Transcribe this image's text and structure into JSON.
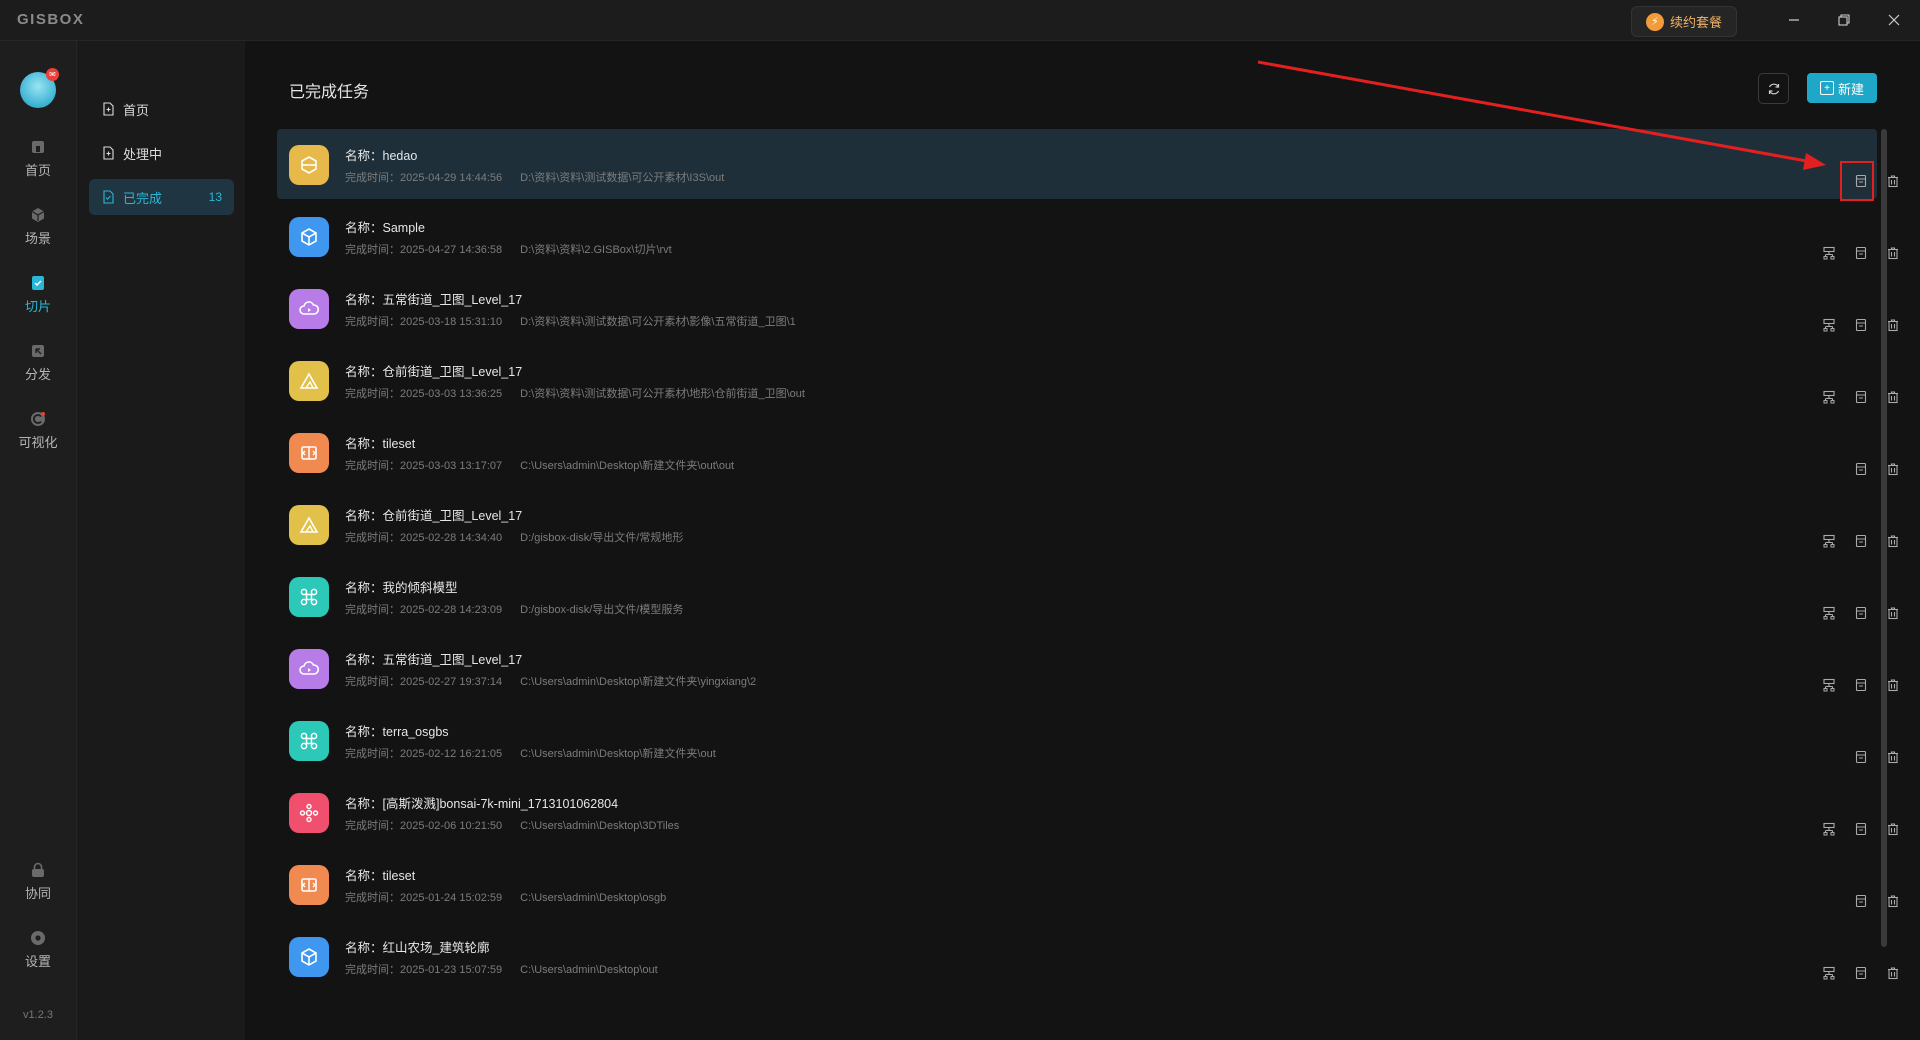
{
  "app": {
    "logo": "GISBOX",
    "renew_label": "续约套餐",
    "version": "v1.2.3"
  },
  "nav": {
    "items": [
      {
        "label": "首页",
        "icon": "home-icon"
      },
      {
        "label": "场景",
        "icon": "scene-icon"
      },
      {
        "label": "切片",
        "icon": "slice-icon",
        "active": true
      },
      {
        "label": "分发",
        "icon": "distribute-icon"
      },
      {
        "label": "可视化",
        "icon": "visualize-icon"
      }
    ],
    "bottom_items": [
      {
        "label": "协同",
        "icon": "collab-icon"
      },
      {
        "label": "设置",
        "icon": "settings-icon"
      }
    ]
  },
  "subnav": {
    "items": [
      {
        "label": "首页",
        "icon": "doc-icon"
      },
      {
        "label": "处理中",
        "icon": "doc-icon"
      },
      {
        "label": "已完成",
        "icon": "doc-check-icon",
        "count": "13",
        "active": true
      }
    ]
  },
  "main": {
    "title": "已完成任务",
    "new_label": "新建",
    "name_prefix": "名称：",
    "time_prefix": "完成时间：",
    "tasks": [
      {
        "name": "hedao",
        "time": "2025-04-29 14:44:56",
        "path": "D:\\资料\\资料\\测试数据\\可公开素材\\I3S\\out",
        "icon": "i3s-icon",
        "color": "#e6b94a",
        "has_publish": false
      },
      {
        "name": "Sample",
        "time": "2025-04-27 14:36:58",
        "path": "D:\\资料\\资料\\2.GISBox\\切片\\rvt",
        "icon": "cube-icon",
        "color": "#3f97f0",
        "has_publish": true
      },
      {
        "name": "五常街道_卫图_Level_17",
        "time": "2025-03-18 15:31:10",
        "path": "D:\\资料\\资料\\测试数据\\可公开素材\\影像\\五常街道_卫图\\1",
        "icon": "image-cloud-icon",
        "color": "#b77ce8",
        "has_publish": true
      },
      {
        "name": "仓前街道_卫图_Level_17",
        "time": "2025-03-03 13:36:25",
        "path": "D:\\资料\\资料\\测试数据\\可公开素材\\地形\\仓前街道_卫图\\out",
        "icon": "terrain-icon",
        "color": "#e2c14a",
        "has_publish": true
      },
      {
        "name": "tileset",
        "time": "2025-03-03 13:17:07",
        "path": "C:\\Users\\admin\\Desktop\\新建文件夹\\out\\out",
        "icon": "tileset-icon",
        "color": "#f08a50",
        "has_publish": false
      },
      {
        "name": "仓前街道_卫图_Level_17",
        "time": "2025-02-28 14:34:40",
        "path": "D:/gisbox-disk/导出文件/常规地形",
        "icon": "terrain-icon",
        "color": "#e2c14a",
        "has_publish": true
      },
      {
        "name": "我的倾斜模型",
        "time": "2025-02-28 14:23:09",
        "path": "D:/gisbox-disk/导出文件/模型服务",
        "icon": "drone-icon",
        "color": "#2cc8b8",
        "has_publish": true
      },
      {
        "name": "五常街道_卫图_Level_17",
        "time": "2025-02-27 19:37:14",
        "path": "C:\\Users\\admin\\Desktop\\新建文件夹\\yingxiang\\2",
        "icon": "image-cloud-icon",
        "color": "#b77ce8",
        "has_publish": true
      },
      {
        "name": "terra_osgbs",
        "time": "2025-02-12 16:21:05",
        "path": "C:\\Users\\admin\\Desktop\\新建文件夹\\out",
        "icon": "drone-icon",
        "color": "#2cc8b8",
        "has_publish": false
      },
      {
        "name": "[高斯泼溅]bonsai-7k-mini_1713101062804",
        "time": "2025-02-06 10:21:50",
        "path": "C:\\Users\\admin\\Desktop\\3DTiles",
        "icon": "gaussian-icon",
        "color": "#f0506e",
        "has_publish": true
      },
      {
        "name": "tileset",
        "time": "2025-01-24 15:02:59",
        "path": "C:\\Users\\admin\\Desktop\\osgb",
        "icon": "tileset-icon",
        "color": "#f08a50",
        "has_publish": false
      },
      {
        "name": "红山农场_建筑轮廓",
        "time": "2025-01-23 15:07:59",
        "path": "C:\\Users\\admin\\Desktop\\out",
        "icon": "cube-icon",
        "color": "#3f97f0",
        "has_publish": true
      }
    ]
  },
  "colors": {
    "accent": "#1fa7c7",
    "annotation": "#e32020"
  }
}
